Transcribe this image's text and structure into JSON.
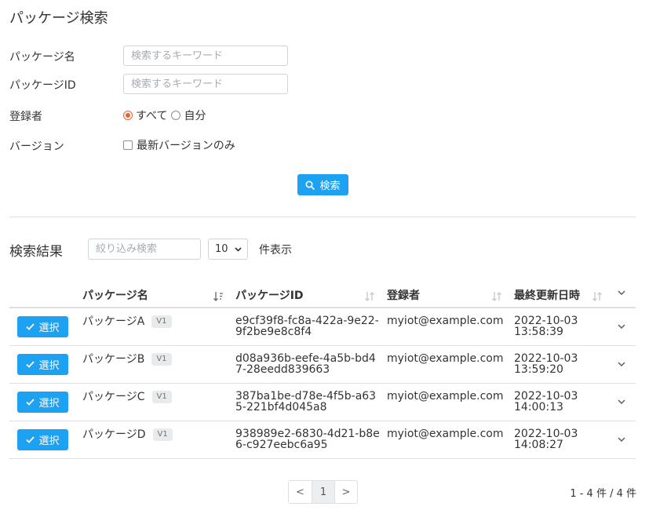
{
  "page_title": "パッケージ検索",
  "form": {
    "package_name_label": "パッケージ名",
    "package_name_placeholder": "検索するキーワード",
    "package_id_label": "パッケージID",
    "package_id_placeholder": "検索するキーワード",
    "registrant_label": "登録者",
    "registrant_options": [
      "すべて",
      "自分"
    ],
    "registrant_selected": "すべて",
    "version_label": "バージョン",
    "latest_only_label": "最新バージョンのみ",
    "latest_only_checked": false,
    "search_button_label": "検索"
  },
  "results": {
    "title": "検索結果",
    "filter_placeholder": "絞り込み検索",
    "page_size": "10",
    "page_size_label": "件表示",
    "columns": [
      "パッケージ名",
      "パッケージID",
      "登録者",
      "最終更新日時"
    ],
    "select_button_label": "選択",
    "rows": [
      {
        "name": "パッケージA",
        "version": "V1",
        "id": "e9cf39f8-fc8a-422a-9e22-9f2be9e8c8f4",
        "registrant": "myiot@example.com",
        "updated_date": "2022-10-03",
        "updated_time": "13:58:39"
      },
      {
        "name": "パッケージB",
        "version": "V1",
        "id": "d08a936b-eefe-4a5b-bd47-28eedd839663",
        "registrant": "myiot@example.com",
        "updated_date": "2022-10-03",
        "updated_time": "13:59:20"
      },
      {
        "name": "パッケージC",
        "version": "V1",
        "id": "387ba1be-d78e-4f5b-a635-221bf4d045a8",
        "registrant": "myiot@example.com",
        "updated_date": "2022-10-03",
        "updated_time": "14:00:13"
      },
      {
        "name": "パッケージD",
        "version": "V1",
        "id": "938989e2-6830-4d21-b8e6-c927eebc6a95",
        "registrant": "myiot@example.com",
        "updated_date": "2022-10-03",
        "updated_time": "14:08:27"
      }
    ]
  },
  "pagination": {
    "prev": "<",
    "current": "1",
    "next": ">",
    "summary": "1 - 4 件 / 4 件"
  },
  "colors": {
    "primary": "#1da1f2",
    "radio_accent": "#e8612c",
    "border": "#dcdfe3"
  },
  "icons": {
    "search": "search-icon",
    "check": "check-icon",
    "sort": "sort-icon",
    "chevron": "chevron-down-icon"
  }
}
